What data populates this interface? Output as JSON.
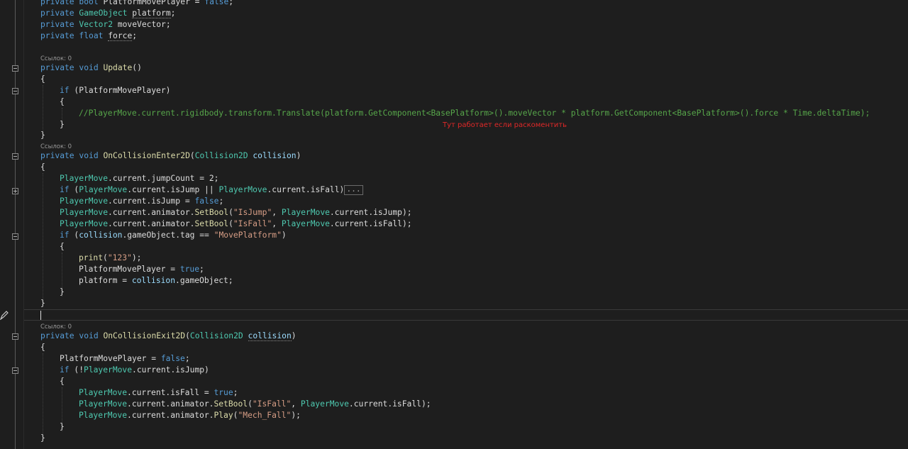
{
  "code_lens": {
    "update": "Ссылок: 0",
    "enter": "Ссылок: 0",
    "exit": "Ссылок: 0"
  },
  "annotation": "Тут работает если раскоментить",
  "colors": {
    "background": "#1e1e1e",
    "keyword": "#569cd6",
    "type": "#4ec9b0",
    "method": "#dcdcaa",
    "string": "#d69d85",
    "comment": "#57a64a",
    "annotation": "#e02828"
  },
  "code": {
    "l1": [
      "private",
      " ",
      "bool",
      " PlatformMovePlayer = ",
      "false",
      ";"
    ],
    "l2": [
      "private",
      " ",
      "GameObject",
      " ",
      "platform",
      ";"
    ],
    "l3": [
      "private",
      " ",
      "Vector2",
      " moveVector;"
    ],
    "l4": [
      "private",
      " ",
      "float",
      " ",
      "force",
      ";"
    ],
    "l5": [
      "private",
      " ",
      "void",
      " ",
      "Update",
      "()"
    ],
    "l6": "{",
    "l7": [
      "if",
      " (PlatformMovePlayer)"
    ],
    "l8": "{",
    "l9": "//PlayerMove.current.rigidbody.transform.Translate(platform.GetComponent<BasePlatform>().moveVector * platform.GetComponent<BasePlatform>().force * Time.deltaTime);",
    "l10": "}",
    "l11": "}",
    "l12": [
      "private",
      " ",
      "void",
      " ",
      "OnCollisionEnter2D",
      "(",
      "Collision2D",
      " ",
      "collision",
      ")"
    ],
    "l13": "{",
    "l14": [
      "PlayerMove",
      ".current.jumpCount = 2;"
    ],
    "l15": [
      "if",
      " (",
      "PlayerMove",
      ".current.isJump || ",
      "PlayerMove",
      ".current.isFall)",
      "..."
    ],
    "l16": [
      "PlayerMove",
      ".current.isJump = ",
      "false",
      ";"
    ],
    "l17": [
      "PlayerMove",
      ".current.animator.",
      "SetBool",
      "(",
      "\"IsJump\"",
      ", ",
      "PlayerMove",
      ".current.isJump);"
    ],
    "l18": [
      "PlayerMove",
      ".current.animator.",
      "SetBool",
      "(",
      "\"IsFall\"",
      ", ",
      "PlayerMove",
      ".current.isFall);"
    ],
    "l19": [
      "if",
      " (",
      "collision",
      ".gameObject.tag == ",
      "\"MovePlatform\"",
      ")"
    ],
    "l20": "{",
    "l21": [
      "print",
      "(",
      "\"123\"",
      ");"
    ],
    "l22": [
      "PlatformMovePlayer = ",
      "true",
      ";"
    ],
    "l23": [
      "platform = ",
      "collision",
      ".gameObject;"
    ],
    "l24": "}",
    "l25": "}",
    "l26": [
      "private",
      " ",
      "void",
      " ",
      "OnCollisionExit2D",
      "(",
      "Collision2D",
      " ",
      "collision",
      ")"
    ],
    "l27": "{",
    "l28": [
      "PlatformMovePlayer = ",
      "false",
      ";"
    ],
    "l29": [
      "if",
      " (!",
      "PlayerMove",
      ".current.isJump)"
    ],
    "l30": "{",
    "l31": [
      "PlayerMove",
      ".current.isFall = ",
      "true",
      ";"
    ],
    "l32": [
      "PlayerMove",
      ".current.animator.",
      "SetBool",
      "(",
      "\"IsFall\"",
      ", ",
      "PlayerMove",
      ".current.isFall);"
    ],
    "l33": [
      "PlayerMove",
      ".current.animator.",
      "Play",
      "(",
      "\"Mech_Fall\"",
      ");"
    ],
    "l34": "}",
    "l35": "}"
  }
}
